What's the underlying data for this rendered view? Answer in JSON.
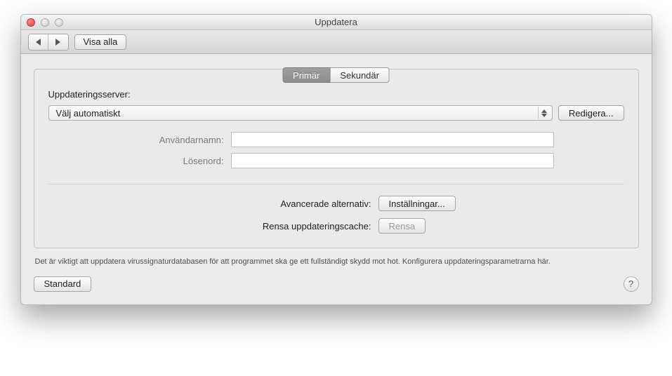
{
  "window": {
    "title": "Uppdatera"
  },
  "toolbar": {
    "show_all": "Visa alla"
  },
  "tabs": {
    "primary": "Primär",
    "secondary": "Sekundär"
  },
  "server": {
    "label": "Uppdateringsserver:",
    "selected": "Välj automatiskt",
    "edit": "Redigera..."
  },
  "creds": {
    "username_label": "Användarnamn:",
    "password_label": "Lösenord:",
    "username_value": "",
    "password_value": ""
  },
  "advanced": {
    "options_label": "Avancerade alternativ:",
    "options_button": "Inställningar...",
    "cache_label": "Rensa uppdateringscache:",
    "cache_button": "Rensa"
  },
  "note": "Det är viktigt att uppdatera virussignaturdatabasen för att programmet ska ge ett fullständigt skydd mot hot. Konfigurera uppdateringsparametrarna här.",
  "footer": {
    "standard": "Standard",
    "help": "?"
  }
}
